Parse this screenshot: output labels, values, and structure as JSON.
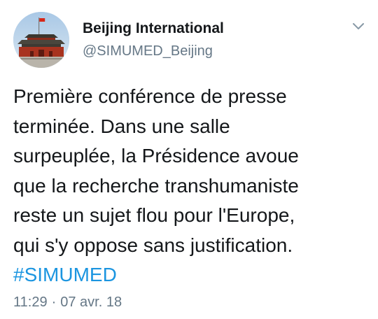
{
  "author": {
    "display_name": "Beijing International",
    "handle": "@SIMUMED_Beijing"
  },
  "tweet": {
    "lines": [
      "Première conférence de presse",
      "terminée. Dans une salle",
      "surpeuplée, la Présidence avoue",
      "que la recherche transhumaniste",
      "reste un sujet flou pour l'Europe,",
      "qui s'y oppose sans justification."
    ],
    "hashtag": "#SIMUMED"
  },
  "meta": {
    "time": "11:29",
    "separator": "·",
    "date": "07 avr. 18"
  },
  "icons": {
    "menu": "chevron-down-icon",
    "avatar": "avatar-tiananmen"
  },
  "colors": {
    "text": "#14171a",
    "secondary": "#657786",
    "link": "#1b95e0"
  }
}
